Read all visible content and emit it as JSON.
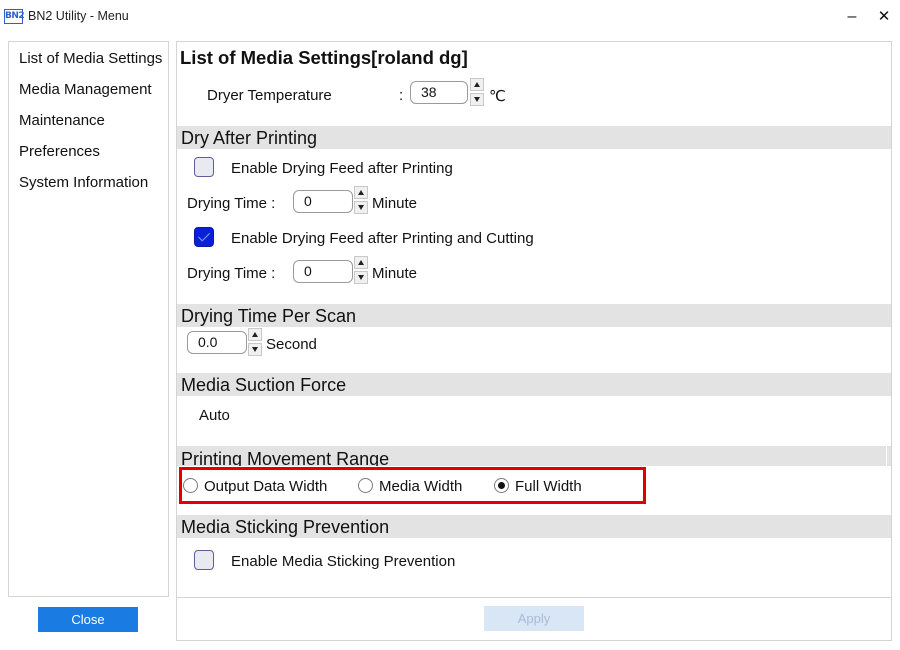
{
  "window": {
    "app_icon_text": "BN2",
    "title": "BN2 Utility - Menu",
    "minimize_glyph": "–",
    "close_glyph": "✕"
  },
  "sidebar": {
    "items": [
      {
        "label": "List of Media Settings"
      },
      {
        "label": "Media Management"
      },
      {
        "label": "Maintenance"
      },
      {
        "label": "Preferences"
      },
      {
        "label": "System Information"
      }
    ],
    "close_label": "Close"
  },
  "main": {
    "title": "List of Media Settings[roland dg]",
    "dryer_temperature": {
      "label": "Dryer Temperature",
      "separator": ":",
      "value": "38",
      "unit": "℃"
    },
    "dry_after_printing": {
      "heading": "Dry After Printing",
      "feed_after_printing": {
        "label": "Enable Drying Feed after Printing",
        "checked": false
      },
      "drying_time_1": {
        "label": "Drying Time :",
        "value": "0",
        "unit": "Minute"
      },
      "feed_after_printing_cutting": {
        "label": "Enable Drying Feed after Printing and Cutting",
        "checked": true
      },
      "drying_time_2": {
        "label": "Drying Time :",
        "value": "0",
        "unit": "Minute"
      }
    },
    "drying_time_per_scan": {
      "heading": "Drying Time Per Scan",
      "value": "0.0",
      "unit": "Second"
    },
    "media_suction_force": {
      "heading": "Media Suction Force",
      "value": "Auto"
    },
    "printing_movement_range": {
      "heading": "Printing Movement Range",
      "options": [
        {
          "label": "Output Data Width",
          "selected": false
        },
        {
          "label": "Media Width",
          "selected": false
        },
        {
          "label": "Full Width",
          "selected": true
        }
      ]
    },
    "media_sticking_prevention": {
      "heading": "Media Sticking Prevention",
      "enable": {
        "label": "Enable Media Sticking Prevention",
        "checked": false
      }
    },
    "apply_label": "Apply"
  },
  "colors": {
    "accent": "#1a7ce2",
    "highlight": "#e00000",
    "section_header_bg": "#e3e3e3",
    "checkbox_checked": "#0a20d8"
  }
}
